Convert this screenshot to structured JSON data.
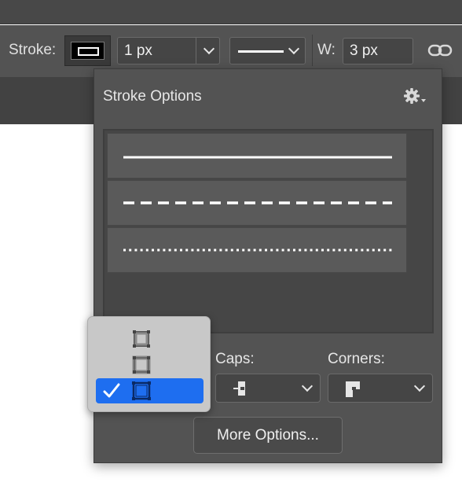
{
  "toolbar": {
    "stroke_label": "Stroke:",
    "stroke_width_value": "1 px",
    "stroke_style": "solid",
    "width_label": "W:",
    "width_value": "3 px",
    "link_icon": "link-icon"
  },
  "panel": {
    "title": "Stroke Options",
    "gear_icon": "gear-icon",
    "styles": [
      "solid",
      "dashed",
      "dotted"
    ],
    "caps_label": "Caps:",
    "corners_label": "Corners:",
    "more_options_label": "More Options..."
  },
  "align_popup": {
    "items": [
      "inside",
      "center",
      "outside"
    ],
    "selected": "outside"
  },
  "colors": {
    "bar_bg": "#535353",
    "panel_bg": "#535353",
    "selection_blue": "#1e6ef0"
  }
}
